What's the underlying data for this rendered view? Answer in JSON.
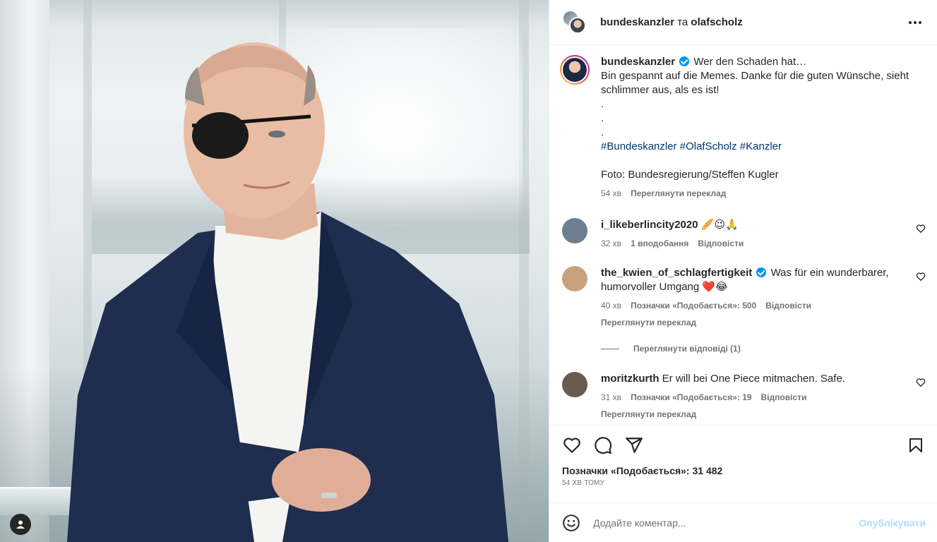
{
  "header": {
    "user1": "bundeskanzler",
    "conjunction": "та",
    "user2": "olafscholz"
  },
  "post": {
    "username": "bundeskanzler",
    "line1": "Wer den Schaden hat…",
    "line2": "Bin gespannt auf die Memes. Danke für die guten Wünsche, sieht schlimmer aus, als es ist!",
    "dot1": ".",
    "dot2": ".",
    "dot3": ".",
    "hashtags": [
      "#Bundeskanzler",
      "#OlafScholz",
      "#Kanzler"
    ],
    "credit": "Foto: Bundesregierung/Steffen Kugler",
    "time": "54 хв",
    "see_translation": "Переглянути переклад"
  },
  "comments": [
    {
      "username": "i_likeberlincity2020",
      "text": "🥖😉🙏",
      "time": "32 хв",
      "likes": "1 вподобання",
      "reply": "Відповісти",
      "avatar_color": "#6d7f8f"
    },
    {
      "username": "the_kwien_of_schlagfertigkeit",
      "text": "Was für ein wunderbarer, humorvoller Umgang ❤️😂",
      "time": "40 хв",
      "likes": "Позначки «Подобається»: 500",
      "reply": "Відповісти",
      "translation": "Переглянути переклад",
      "avatar_color": "#c9a27d"
    },
    {
      "username": "moritzkurth",
      "text": "Er will bei One Piece mitmachen. Safe.",
      "time": "31 хв",
      "likes": "Позначки «Подобається»: 19",
      "reply": "Відповісти",
      "translation": "Переглянути переклад",
      "avatar_color": "#6b5a4e"
    }
  ],
  "view_replies": "Переглянути відповіді (1)",
  "footer": {
    "likes": "Позначки «Подобається»: 31 482",
    "time": "54 ХВ ТОМУ"
  },
  "comment_input": {
    "placeholder": "Додайте коментар...",
    "publish": "Опублікувати"
  }
}
